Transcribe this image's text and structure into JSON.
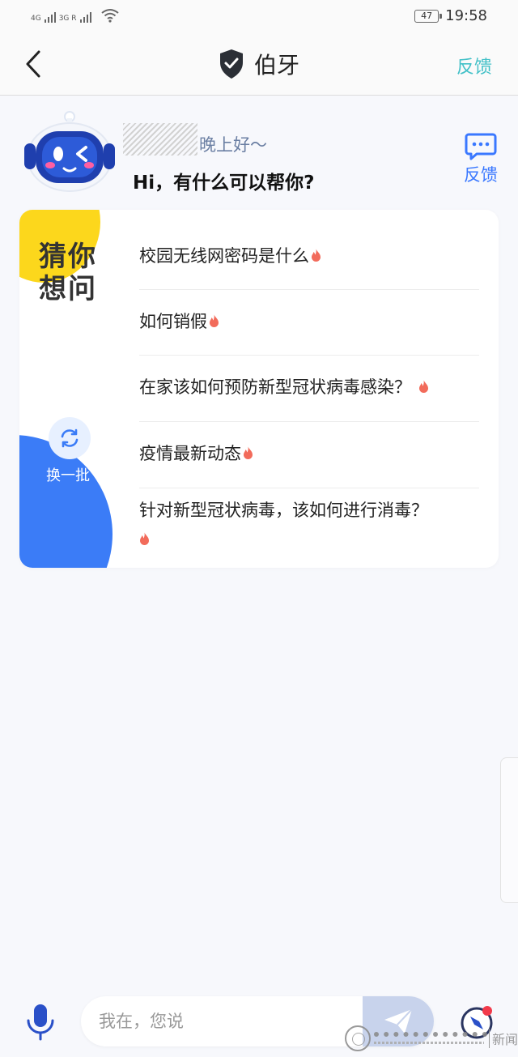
{
  "status_bar": {
    "net1": "4G",
    "net2": "3G R",
    "battery": "47",
    "battery_level_percent": 47,
    "time": "19:58"
  },
  "header": {
    "title": "伯牙",
    "feedback": "反馈",
    "icons": {
      "back": "chevron-left-icon",
      "shield": "shield-check-icon"
    }
  },
  "greeting": {
    "suffix": "晚上好～",
    "headline": "Hi，有什么可以帮你?",
    "feedback_label": "反馈"
  },
  "suggestions": {
    "label": "猜你想问",
    "refresh_label": "换一批",
    "questions": [
      "校园无线网密码是什么",
      "如何销假",
      "在家该如何预防新型冠状病毒感染？",
      "疫情最新动态",
      "针对新型冠状病毒，该如何进行消毒？"
    ]
  },
  "input": {
    "placeholder": "我在，您说"
  },
  "watermark": {
    "text": "新闻网"
  },
  "colors": {
    "accent_teal": "#44c1c8",
    "accent_blue": "#3a78ff",
    "card_blue": "#3b7cf7",
    "card_yellow": "#fcd71c",
    "fire": "#f26b5b",
    "background": "#f7f8fc"
  }
}
